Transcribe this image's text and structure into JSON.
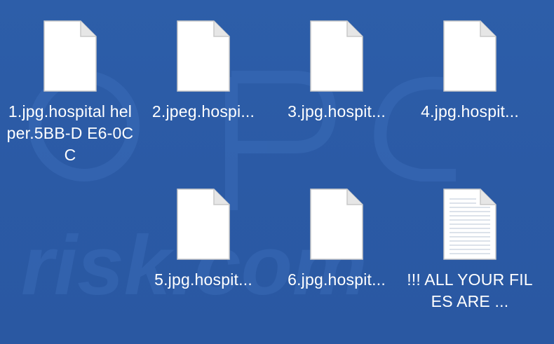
{
  "desktop": {
    "background_color": "#2b5aa6",
    "watermark_text": "risk.com",
    "files": [
      {
        "label": "1.jpg.hospital helper.5BB-D E6-0CC",
        "icon": "blank-file-icon"
      },
      {
        "label": "2.jpeg.hospi...",
        "icon": "blank-file-icon"
      },
      {
        "label": "3.jpg.hospit...",
        "icon": "blank-file-icon"
      },
      {
        "label": "4.jpg.hospit...",
        "icon": "blank-file-icon"
      },
      {
        "label": "5.jpg.hospit...",
        "icon": "blank-file-icon"
      },
      {
        "label": "6.jpg.hospit...",
        "icon": "blank-file-icon"
      },
      {
        "label": "!!! ALL YOUR FILES ARE ...",
        "icon": "text-document-icon"
      }
    ]
  }
}
